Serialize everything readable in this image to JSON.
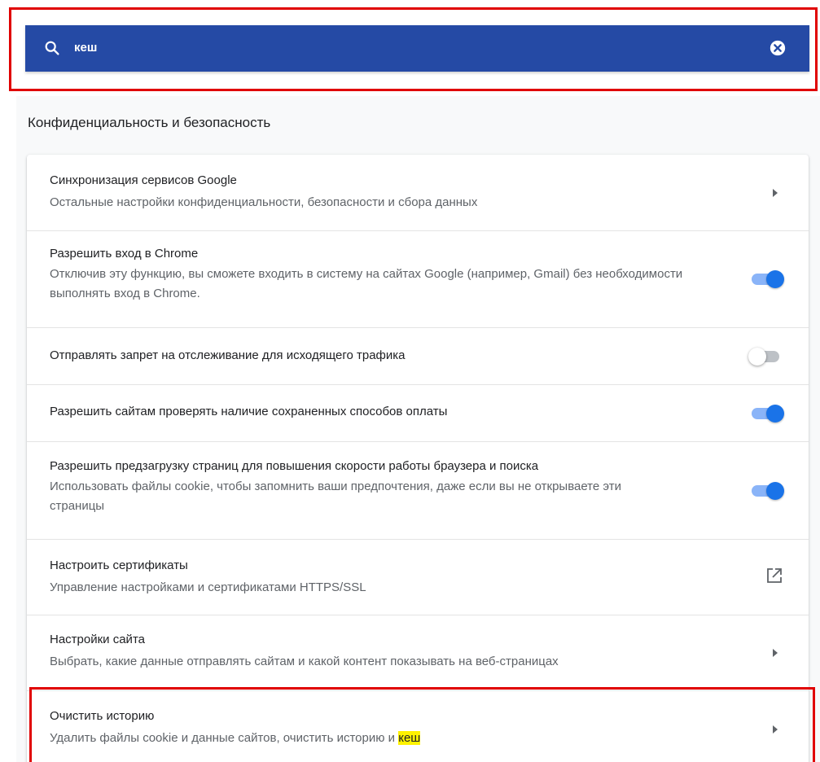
{
  "search": {
    "value": "кеш"
  },
  "section": {
    "title": "Конфиденциальность и безопасность"
  },
  "rows": [
    {
      "title": "Синхронизация сервисов Google",
      "desc": "Остальные настройки конфиденциальности, безопасности и сбора данных",
      "control": "chevron"
    },
    {
      "title": "Разрешить вход в Chrome",
      "desc": "Отключив эту функцию, вы сможете входить в систему на сайтах Google (например, Gmail) без необходимости выполнять вход в Chrome.",
      "control": "toggle",
      "state": "on"
    },
    {
      "title": "Отправлять запрет на отслеживание для исходящего трафика",
      "control": "toggle",
      "state": "off"
    },
    {
      "title": "Разрешить сайтам проверять наличие сохраненных способов оплаты",
      "control": "toggle",
      "state": "on"
    },
    {
      "title": "Разрешить предзагрузку страниц для повышения скорости работы браузера и поиска",
      "desc": "Использовать файлы cookie, чтобы запомнить ваши предпочтения, даже если вы не открываете эти страницы",
      "control": "toggle",
      "state": "on"
    },
    {
      "title": "Настроить сертификаты",
      "desc": "Управление настройками и сертификатами HTTPS/SSL",
      "control": "external-link"
    },
    {
      "title": "Настройки сайта",
      "desc": "Выбрать, какие данные отправлять сайтам и какой контент показывать на веб-страницах",
      "control": "chevron"
    },
    {
      "title": "Очистить историю",
      "desc_prefix": "Удалить файлы cookie и данные сайтов, очистить историю и ",
      "desc_highlight": "кеш",
      "control": "chevron"
    }
  ],
  "colors": {
    "search_bar": "#254aa5",
    "toggle_on": "#1a73e8",
    "highlight": "#fff200",
    "annotation_border": "#e00000"
  },
  "icons": [
    "search-icon",
    "clear-icon",
    "chevron-right-icon",
    "external-link-icon"
  ]
}
